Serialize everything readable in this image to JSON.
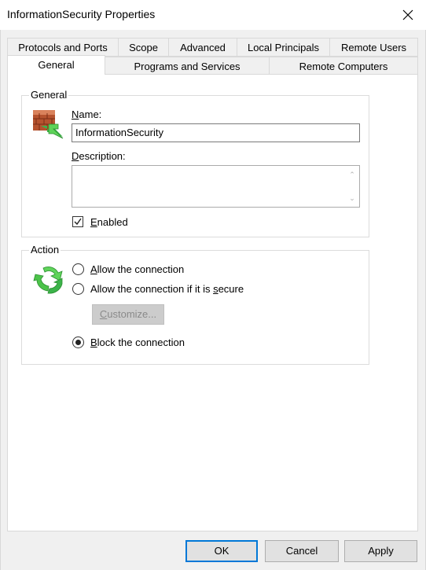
{
  "window": {
    "title": "InformationSecurity Properties"
  },
  "tabs": {
    "row1": [
      "Protocols and Ports",
      "Scope",
      "Advanced",
      "Local Principals",
      "Remote Users"
    ],
    "row2": [
      "General",
      "Programs and Services",
      "Remote Computers"
    ],
    "active": "General"
  },
  "general": {
    "group_label": "General",
    "name_label_u": "N",
    "name_label_rest": "ame:",
    "name_value": "InformationSecurity",
    "description_label_u": "D",
    "description_label_rest": "escription:",
    "description_value": "",
    "enabled_label_u": "E",
    "enabled_label_rest": "nabled",
    "enabled_checked": true
  },
  "action": {
    "group_label": "Action",
    "options": [
      {
        "pre": "",
        "u": "A",
        "post": "llow the connection",
        "checked": false
      },
      {
        "pre": "Allow the connection if it is ",
        "u": "s",
        "post": "ecure",
        "checked": false
      },
      {
        "pre": "",
        "u": "B",
        "post": "lock the connection",
        "checked": true
      }
    ],
    "customize_pre": "",
    "customize_u": "C",
    "customize_post": "ustomize..."
  },
  "buttons": {
    "ok": "OK",
    "cancel": "Cancel",
    "apply": "Apply"
  },
  "colors": {
    "default_button_border": "#0078d7",
    "panel_bg": "#ffffff",
    "dialog_bg": "#f0f0f0"
  }
}
